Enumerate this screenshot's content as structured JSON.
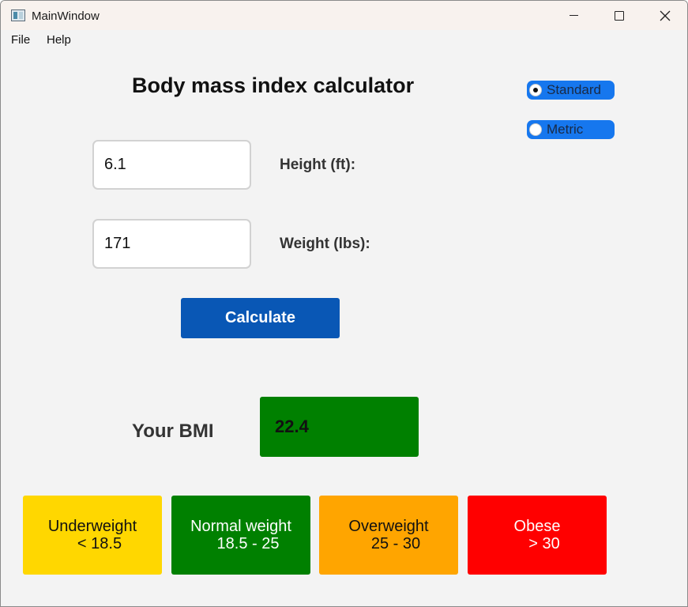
{
  "window": {
    "title": "MainWindow",
    "icons": {
      "app": "app-window-icon",
      "minimize": "minimize-icon",
      "maximize": "maximize-icon",
      "close": "close-icon"
    }
  },
  "menu": {
    "file": "File",
    "help": "Help"
  },
  "heading": "Body mass index calculator",
  "units": {
    "standard": {
      "label": "Standard",
      "selected": true
    },
    "metric": {
      "label": "Metric",
      "selected": false
    }
  },
  "height": {
    "value": "6.1",
    "label": "Height (ft):"
  },
  "weight": {
    "value": "171",
    "label": "Weight (lbs):"
  },
  "calculate_label": "Calculate",
  "result": {
    "label": "Your BMI",
    "value": "22.4"
  },
  "categories": [
    {
      "name": "Underweight",
      "range": "< 18.5",
      "color": "#ffd700"
    },
    {
      "name": "Normal weight",
      "range": "18.5 - 25",
      "color": "#008000"
    },
    {
      "name": "Overweight",
      "range": "25 - 30",
      "color": "#ffa500"
    },
    {
      "name": "Obese",
      "range": "> 30",
      "color": "#ff0000"
    }
  ],
  "colors": {
    "accent": "#1677ee",
    "button": "#0957b5",
    "result_bg": "#008000"
  }
}
